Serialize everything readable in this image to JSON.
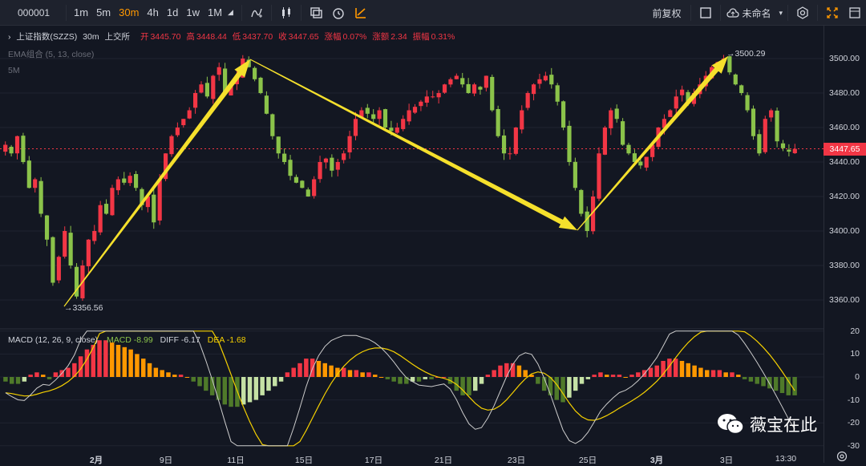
{
  "toolbar": {
    "symbol": "000001",
    "timeframes": [
      "1m",
      "5m",
      "30m",
      "4h",
      "1d",
      "1w",
      "1M"
    ],
    "active_timeframe": "30m",
    "adjust_label": "前复权",
    "layout_label": "未命名",
    "icons": [
      "dropdown-caret-icon",
      "indicator-icon",
      "candle-style-icon",
      "compare-icon",
      "alert-icon",
      "drawing-icon",
      "square-icon",
      "cloud-save-icon",
      "settings-icon",
      "fullscreen-icon",
      "layout-icon"
    ]
  },
  "legend": {
    "title": "上证指数(SZZS)",
    "interval": "30m",
    "exchange": "上交所",
    "open_label": "开",
    "open": "3445.70",
    "high_label": "高",
    "high": "3448.44",
    "low_label": "低",
    "low": "3437.70",
    "close_label": "收",
    "close": "3447.65",
    "change_label": "涨幅",
    "change": "0.07%",
    "amount_label": "涨额",
    "amount": "2.34",
    "amplitude_label": "振幅",
    "amplitude": "0.31%",
    "ema": "EMA组合 (5, 13, close)",
    "interval_tag": "5M"
  },
  "macd_legend": {
    "name": "MACD (12, 26, 9, close)",
    "macd": "MACD -8.99",
    "diff": "DIFF -6.17",
    "dea": "DEA -1.68"
  },
  "price_axis": [
    "3500.00",
    "3480.00",
    "3460.00",
    "3440.00",
    "3420.00",
    "3400.00",
    "3380.00",
    "3360.00"
  ],
  "macd_axis": [
    "20",
    "10",
    "0",
    "-10",
    "-20",
    "-30"
  ],
  "last_price": "3447.65",
  "time_axis": [
    "2月",
    "9日",
    "11日",
    "15日",
    "17日",
    "21日",
    "23日",
    "25日",
    "3月",
    "3日",
    "13:30"
  ],
  "annotations": {
    "low": "→3356.56",
    "high": "→3500.29"
  },
  "watermark": "薇宝在此",
  "colors": {
    "up": "#f23645",
    "down": "#8bc34a",
    "arrow": "#f5e02c",
    "macd_up": "#ff9800",
    "macd_down": "#8bc34a",
    "dea_line": "#f5d000",
    "diff_line": "#cccccc",
    "active_timeframe": "#ff9800"
  },
  "chart_data": {
    "type": "candlestick",
    "y_range": [
      3350,
      3510
    ],
    "macd_range": [
      -32,
      22
    ],
    "key_points": [
      {
        "label": "→3356.56",
        "value": 3356.56
      },
      {
        "label": "→3500.29",
        "value": 3500.29
      }
    ],
    "close_path": [
      3450,
      3445,
      3455,
      3440,
      3425,
      3430,
      3410,
      3395,
      3370,
      3385,
      3400,
      3380,
      3362,
      3380,
      3395,
      3400,
      3415,
      3410,
      3425,
      3430,
      3428,
      3432,
      3425,
      3415,
      3420,
      3405,
      3430,
      3445,
      3455,
      3460,
      3465,
      3470,
      3480,
      3485,
      3478,
      3490,
      3495,
      3480,
      3485,
      3490,
      3500,
      3495,
      3488,
      3480,
      3468,
      3455,
      3445,
      3440,
      3432,
      3428,
      3425,
      3420,
      3430,
      3440,
      3442,
      3435,
      3440,
      3445,
      3455,
      3465,
      3470,
      3468,
      3465,
      3470,
      3460,
      3458,
      3460,
      3465,
      3470,
      3472,
      3475,
      3478,
      3478,
      3480,
      3485,
      3488,
      3490,
      3485,
      3480,
      3485,
      3482,
      3490,
      3470,
      3455,
      3445,
      3445,
      3460,
      3470,
      3480,
      3485,
      3488,
      3490,
      3485,
      3475,
      3460,
      3440,
      3425,
      3410,
      3400,
      3420,
      3445,
      3460,
      3470,
      3465,
      3450,
      3445,
      3440,
      3438,
      3443,
      3450,
      3460,
      3465,
      3470,
      3478,
      3482,
      3475,
      3480,
      3485,
      3490,
      3495,
      3498,
      3500,
      3492,
      3485,
      3480,
      3470,
      3455,
      3445,
      3465,
      3470,
      3452,
      3448,
      3446,
      3447.65
    ],
    "macd_hist": [
      -2,
      -3,
      -3,
      -2,
      1,
      2,
      1,
      -1,
      2,
      3,
      4,
      6,
      9,
      12,
      14,
      16,
      16,
      15,
      14,
      13,
      12,
      10,
      8,
      6,
      4,
      3,
      2,
      1,
      1,
      0,
      -2,
      -4,
      -6,
      -8,
      -10,
      -12,
      -13,
      -13,
      -12,
      -11,
      -10,
      -8,
      -6,
      -4,
      -2,
      2,
      4,
      6,
      8,
      8,
      7,
      6,
      5,
      4,
      4,
      3,
      3,
      2,
      2,
      1,
      0,
      -1,
      -2,
      -3,
      -3,
      -2,
      -2,
      -1,
      -1,
      0,
      0,
      -3,
      -6,
      -8,
      -8,
      -6,
      -3,
      1,
      3,
      5,
      6,
      6,
      5,
      3,
      1,
      -3,
      -6,
      -8,
      -10,
      -11,
      -9,
      -6,
      -3,
      -1,
      1,
      2,
      1,
      1,
      1,
      0,
      1,
      2,
      3,
      4,
      5,
      7,
      8,
      8,
      7,
      6,
      5,
      4,
      3,
      3,
      3,
      2,
      2,
      1,
      -1,
      -2,
      -3,
      -4,
      -5,
      -6,
      -7,
      -8,
      -8
    ]
  }
}
